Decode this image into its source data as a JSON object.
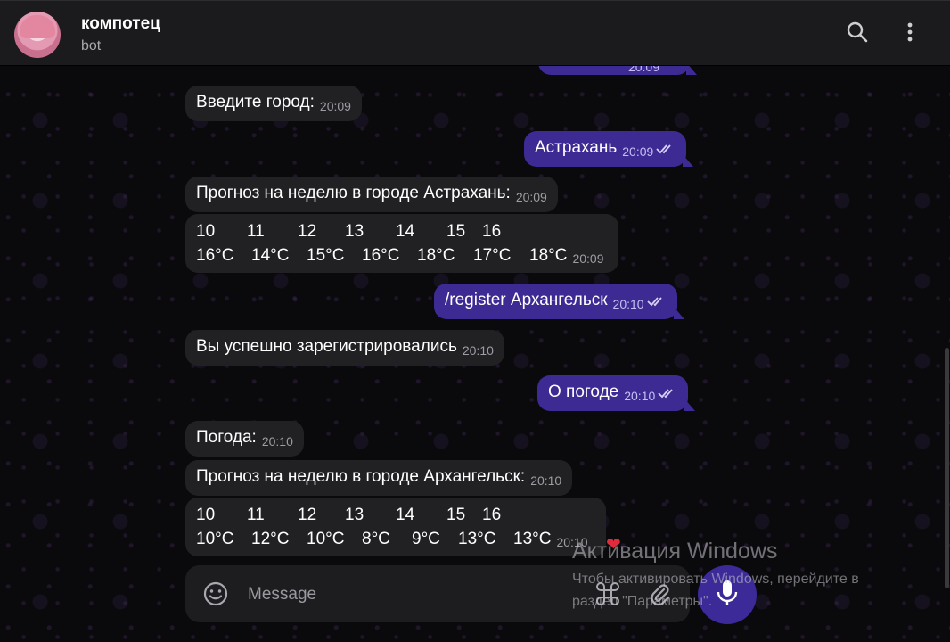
{
  "header": {
    "title": "компотец",
    "subtitle": "bot"
  },
  "messages": [
    {
      "text": "Введите город:",
      "time": "20:09",
      "direction": "in"
    },
    {
      "text": "Астрахань",
      "time": "20:09",
      "direction": "out"
    },
    {
      "text": "Прогноз на неделю в городе Астрахань:",
      "time": "20:09",
      "direction": "in"
    },
    {
      "days": [
        "10",
        "11",
        "12",
        "13",
        "14",
        "15",
        "16"
      ],
      "temps": [
        "16°C",
        "14°C",
        "15°C",
        "16°C",
        "18°C",
        "17°C",
        "18°C"
      ],
      "time": "20:09",
      "direction": "in"
    },
    {
      "text": "/register Архангельск",
      "time": "20:10",
      "direction": "out"
    },
    {
      "text": "Вы успешно зарегистрировались",
      "time": "20:10",
      "direction": "in"
    },
    {
      "text": "О погоде",
      "time": "20:10",
      "direction": "out"
    },
    {
      "text": "Погода:",
      "time": "20:10",
      "direction": "in"
    },
    {
      "text": "Прогноз на неделю в городе Архангельск:",
      "time": "20:10",
      "direction": "in"
    },
    {
      "days": [
        "10",
        "11",
        "12",
        "13",
        "14",
        "15",
        "16"
      ],
      "temps": [
        "10°C",
        "12°C",
        "10°C",
        "8°C",
        "9°C",
        "13°C",
        "13°C"
      ],
      "time": "20:10",
      "direction": "in",
      "reaction": "heart"
    }
  ],
  "clipped_top_message": {
    "time": "20:09"
  },
  "composer": {
    "placeholder": "Message"
  },
  "watermark": {
    "title": "Активация Windows",
    "text": "Чтобы активировать Windows, перейдите в раздел \"Параметры\"."
  },
  "colors": {
    "incoming_bubble": "#212124",
    "outgoing_bubble": "#3d2a93",
    "accent": "#3b2a97",
    "topbar": "#1b1b1d"
  },
  "icons": {
    "search": "search-icon",
    "more": "more-vertical-icon",
    "emoji": "emoji-icon",
    "commands": "command-icon",
    "attach": "paperclip-icon",
    "mic": "microphone-icon",
    "read": "double-check-icon",
    "reaction": "heart-icon"
  }
}
